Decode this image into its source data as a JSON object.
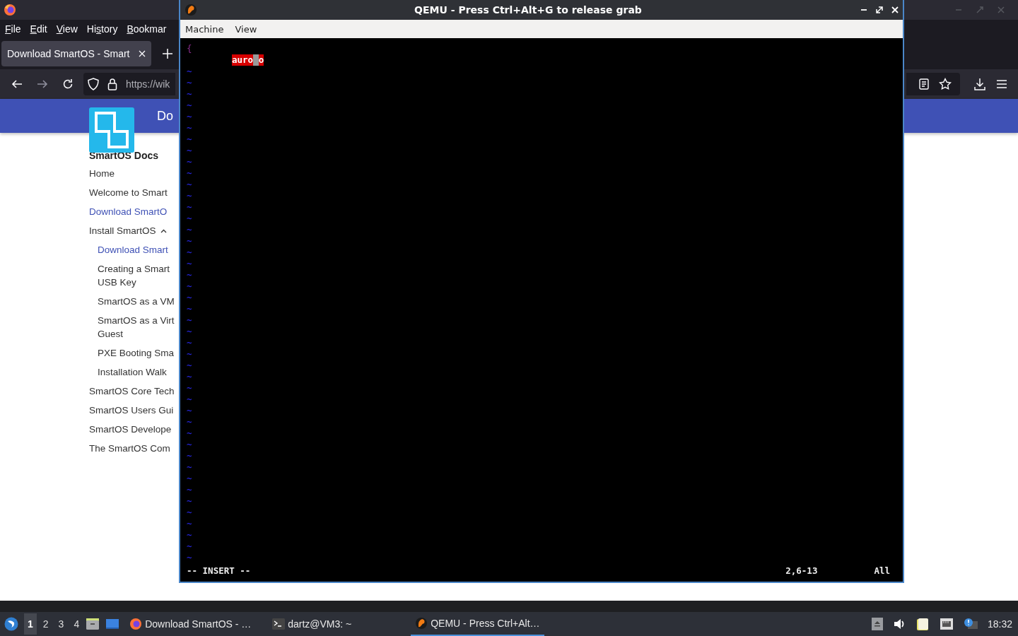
{
  "browser": {
    "menu": [
      {
        "key": "F",
        "rest": "ile"
      },
      {
        "key": "E",
        "rest": "dit"
      },
      {
        "key": "V",
        "rest": "iew"
      },
      {
        "before": "Hi",
        "key": "s",
        "rest": "tory"
      },
      {
        "key": "B",
        "rest": "ookmar"
      }
    ],
    "tab": {
      "title": "Download SmartOS - Smart",
      "selected": true
    },
    "url": "https://wik",
    "forward_disabled": true,
    "page": {
      "header_title": "Do",
      "site_title": "SmartOS Docs",
      "nav": [
        {
          "label": "Home",
          "selected": false
        },
        {
          "label": "Welcome to Smart",
          "selected": false
        },
        {
          "label": "Download SmartO",
          "selected": true
        },
        {
          "label": "Install SmartOS",
          "selected": false,
          "expanded": true,
          "children": [
            {
              "label": "Download Smart",
              "selected": true
            },
            {
              "label": "Creating a Smart\nUSB Key",
              "selected": false
            },
            {
              "label": "SmartOS as a VM",
              "selected": false
            },
            {
              "label": "SmartOS as a Virt\nGuest",
              "selected": false
            },
            {
              "label": "PXE Booting Sma",
              "selected": false
            },
            {
              "label": "Installation Walk",
              "selected": false
            }
          ]
        },
        {
          "label": "SmartOS Core Tech",
          "selected": false
        },
        {
          "label": "SmartOS Users Gui",
          "selected": false
        },
        {
          "label": "SmartOS Develope",
          "selected": false
        },
        {
          "label": "The SmartOS Com",
          "selected": false
        }
      ]
    }
  },
  "qemu": {
    "title": "QEMU - Press Ctrl+Alt+G to release grab",
    "menu": [
      "Machine",
      "View"
    ],
    "vim": {
      "line_1": "{",
      "line_2": {
        "before": "auro",
        "after": "o"
      },
      "tildes": [
        "~",
        "~",
        "~",
        "~",
        "~",
        "~",
        "~",
        "~",
        "~",
        "~",
        "~",
        "~",
        "~",
        "~",
        "~",
        "~",
        "~",
        "~",
        "~",
        "~",
        "~",
        "~",
        "~",
        "~",
        "~",
        "~",
        "~",
        "~",
        "~",
        "~",
        "~",
        "~",
        "~",
        "~",
        "~",
        "~",
        "~",
        "~",
        "~",
        "~",
        "~",
        "~",
        "~",
        "~"
      ],
      "mode": "-- INSERT --",
      "position": "2,6-13",
      "scroll": "All"
    }
  },
  "taskbar": {
    "workspaces": [
      {
        "label": "1",
        "selected": true
      },
      {
        "label": "2",
        "selected": false
      },
      {
        "label": "3",
        "selected": false
      },
      {
        "label": "4",
        "selected": false
      }
    ],
    "tasks": [
      {
        "kind": "firefox",
        "label": "Download SmartOS - …",
        "selected": false
      },
      {
        "kind": "terminal",
        "label": "dartz@VM3: ~",
        "selected": false
      },
      {
        "kind": "qemu",
        "label": "QEMU - Press Ctrl+Alt…",
        "selected": true
      }
    ],
    "clock": "18:32"
  }
}
